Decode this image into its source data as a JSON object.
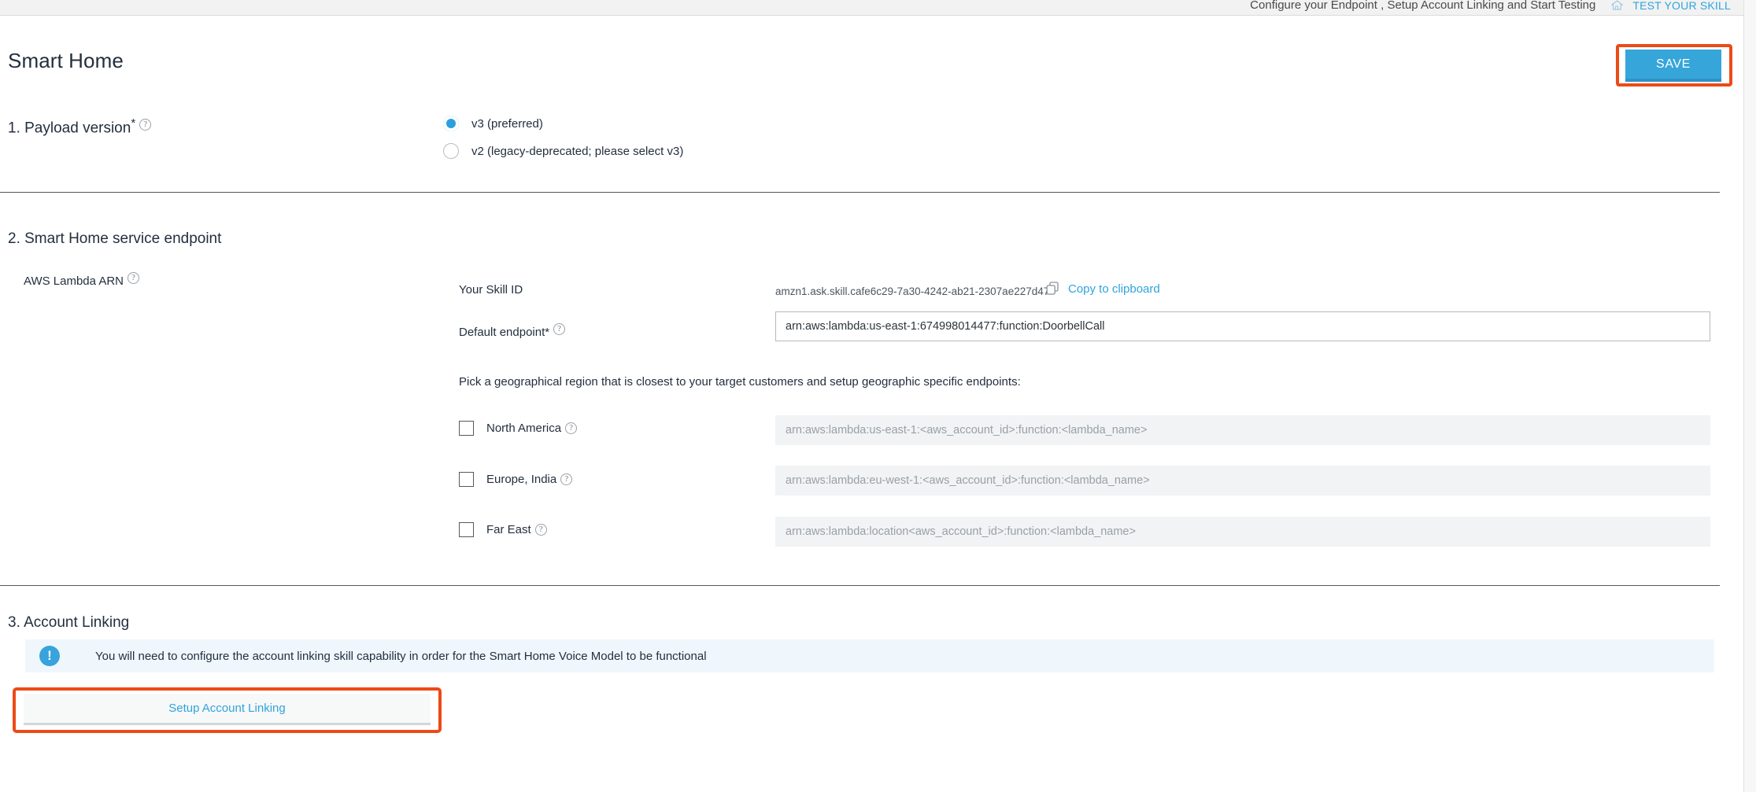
{
  "topbar": {
    "hint": "Configure your Endpoint , Setup Account Linking and Start Testing",
    "home_icon": "home-icon",
    "test_link": "TEST YOUR SKILL"
  },
  "header": {
    "title": "Smart Home",
    "save_label": "SAVE"
  },
  "annotation_color": "#ec4a16",
  "accent_color": "#2fa4dd",
  "sections": {
    "payload": {
      "number_title": "1. Payload version",
      "required_marker": "*",
      "help_icon": "help-circle-icon",
      "options": [
        {
          "label": "v3 (preferred)",
          "checked": true
        },
        {
          "label": "v2 (legacy-deprecated; please select v3)",
          "checked": false
        }
      ]
    },
    "endpoint": {
      "number_title": "2. Smart Home service endpoint",
      "lambda_arn_label": "AWS Lambda ARN",
      "skill_id_label": "Your Skill ID",
      "skill_id_value": "amzn1.ask.skill.cafe6c29-7a30-4242-ab21-2307ae227d47",
      "copy_label": "Copy to clipboard",
      "copy_icon": "copy-icon",
      "default_endpoint_label": "Default endpoint*",
      "default_endpoint_value": "arn:aws:lambda:us-east-1:674998014477:function:DoorbellCall",
      "region_helper": "Pick a geographical region that is closest to your target customers and setup geographic specific endpoints:",
      "regions": [
        {
          "label": "North America",
          "checked": false,
          "placeholder": "arn:aws:lambda:us-east-1:<aws_account_id>:function:<lambda_name>"
        },
        {
          "label": "Europe, India",
          "checked": false,
          "placeholder": "arn:aws:lambda:eu-west-1:<aws_account_id>:function:<lambda_name>"
        },
        {
          "label": "Far East",
          "checked": false,
          "placeholder": "arn:aws:lambda:location<aws_account_id>:function:<lambda_name>"
        }
      ]
    },
    "account_linking": {
      "number_title": "3. Account Linking",
      "info_icon": "exclamation-icon",
      "info_text": "You will need to configure the account linking skill capability in order for the Smart Home Voice Model to be functional",
      "setup_button_label": "Setup Account Linking"
    }
  }
}
